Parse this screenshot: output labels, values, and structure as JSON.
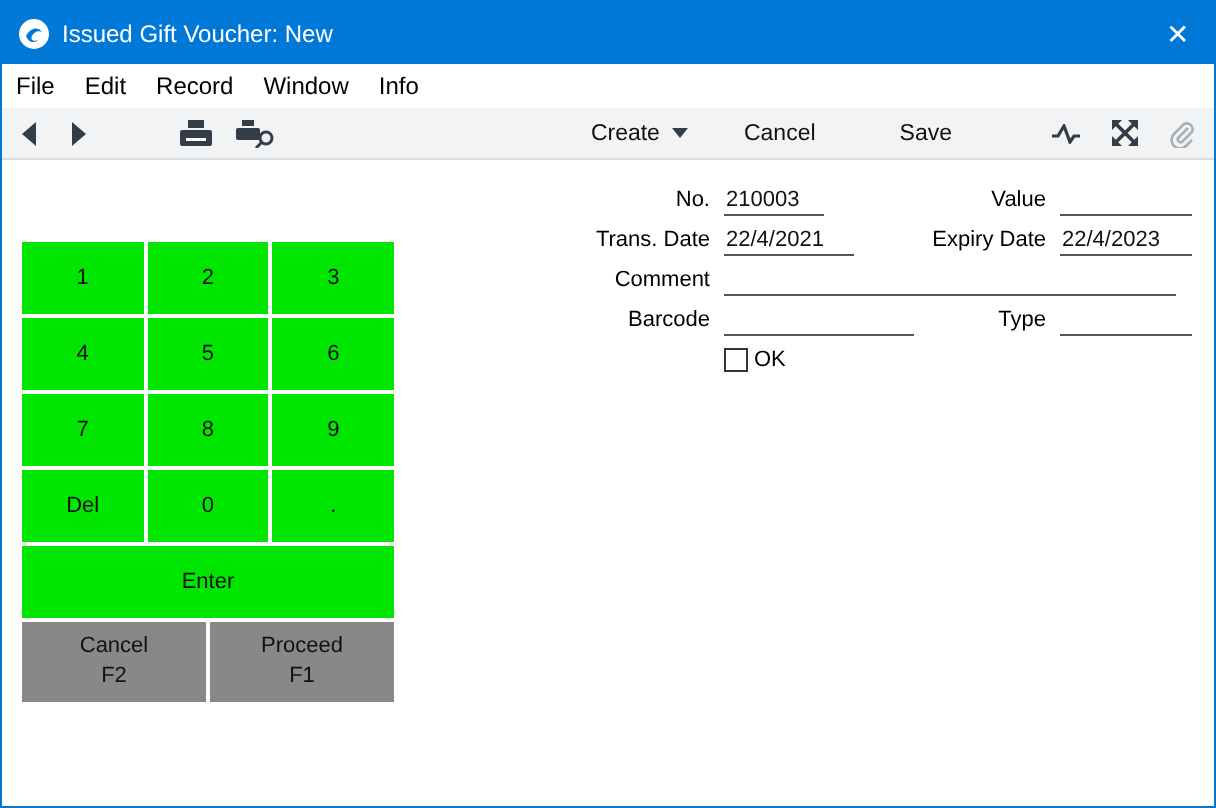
{
  "window": {
    "title": "Issued Gift Voucher: New",
    "close": "✕"
  },
  "menu": [
    "File",
    "Edit",
    "Record",
    "Window",
    "Info"
  ],
  "toolbar": {
    "create": "Create",
    "cancel": "Cancel",
    "save": "Save"
  },
  "keypad": {
    "keys": [
      {
        "label": "1",
        "kind": "key"
      },
      {
        "label": "2",
        "kind": "key"
      },
      {
        "label": "3",
        "kind": "key"
      },
      {
        "label": "4",
        "kind": "key"
      },
      {
        "label": "5",
        "kind": "key"
      },
      {
        "label": "6",
        "kind": "key"
      },
      {
        "label": "7",
        "kind": "key"
      },
      {
        "label": "8",
        "kind": "key"
      },
      {
        "label": "9",
        "kind": "key"
      },
      {
        "label": "Del",
        "kind": "key"
      },
      {
        "label": "0",
        "kind": "key"
      },
      {
        "label": ".",
        "kind": "key"
      },
      {
        "label": "Enter",
        "kind": "wide"
      },
      {
        "label": "Cancel",
        "sub": "F2",
        "kind": "action"
      },
      {
        "label": "Proceed",
        "sub": "F1",
        "kind": "action"
      }
    ]
  },
  "form": {
    "no": {
      "label": "No.",
      "value": "210003"
    },
    "value": {
      "label": "Value"
    },
    "trans_date": {
      "label": "Trans. Date",
      "value": "22/4/2021"
    },
    "expiry_date": {
      "label": "Expiry Date",
      "value": "22/4/2023"
    },
    "comment": {
      "label": "Comment"
    },
    "barcode": {
      "label": "Barcode"
    },
    "type": {
      "label": "Type"
    },
    "ok": {
      "label": "OK",
      "checked": false
    }
  }
}
